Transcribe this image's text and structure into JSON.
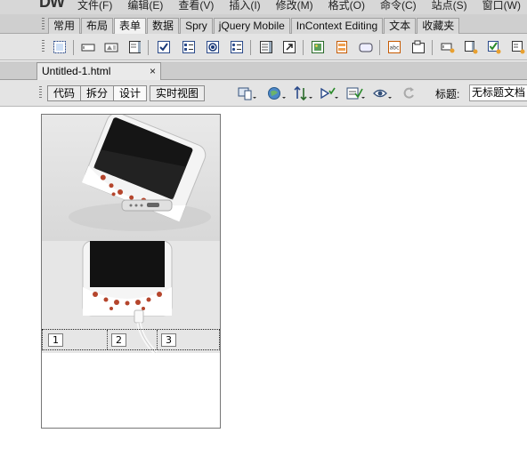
{
  "app": {
    "logo": "DW"
  },
  "menu": [
    "文件(F)",
    "编辑(E)",
    "查看(V)",
    "插入(I)",
    "修改(M)",
    "格式(O)",
    "命令(C)",
    "站点(S)",
    "窗口(W)"
  ],
  "insert_tabs": [
    {
      "label": "常用",
      "active": false
    },
    {
      "label": "布局",
      "active": false
    },
    {
      "label": "表单",
      "active": true
    },
    {
      "label": "数据",
      "active": false
    },
    {
      "label": "Spry",
      "active": false
    },
    {
      "label": "jQuery Mobile",
      "active": false
    },
    {
      "label": "InContext Editing",
      "active": false
    },
    {
      "label": "文本",
      "active": false
    },
    {
      "label": "收藏夹",
      "active": false
    }
  ],
  "form_toolbar_icons": [
    "form-icon",
    "text-field-icon",
    "hidden-field-icon",
    "textarea-icon",
    "checkbox-icon",
    "checkbox-group-icon",
    "radio-button-icon",
    "radio-group-icon",
    "select-list-icon",
    "jump-menu-icon",
    "image-field-icon",
    "file-field-icon",
    "button-icon",
    "label-icon",
    "fieldset-icon",
    "spry-text-field-icon",
    "spry-textarea-icon",
    "spry-checkbox-icon",
    "spry-select-icon"
  ],
  "document": {
    "tab_name": "Untitled-1.html",
    "close_glyph": "×"
  },
  "doc_toolbar": {
    "views": [
      {
        "label": "代码",
        "active": false
      },
      {
        "label": "拆分",
        "active": false
      },
      {
        "label": "设计",
        "active": true
      },
      {
        "label": "实时视图",
        "active": false
      }
    ],
    "title_label": "标题:",
    "title_value": "无标题文档"
  },
  "canvas": {
    "cells": [
      "1",
      "2",
      "3"
    ]
  },
  "colors": {
    "menubar_bg": "#d7d7d7",
    "toolbar_bg": "#e4e4e4",
    "case_dots": "#b5452c"
  }
}
